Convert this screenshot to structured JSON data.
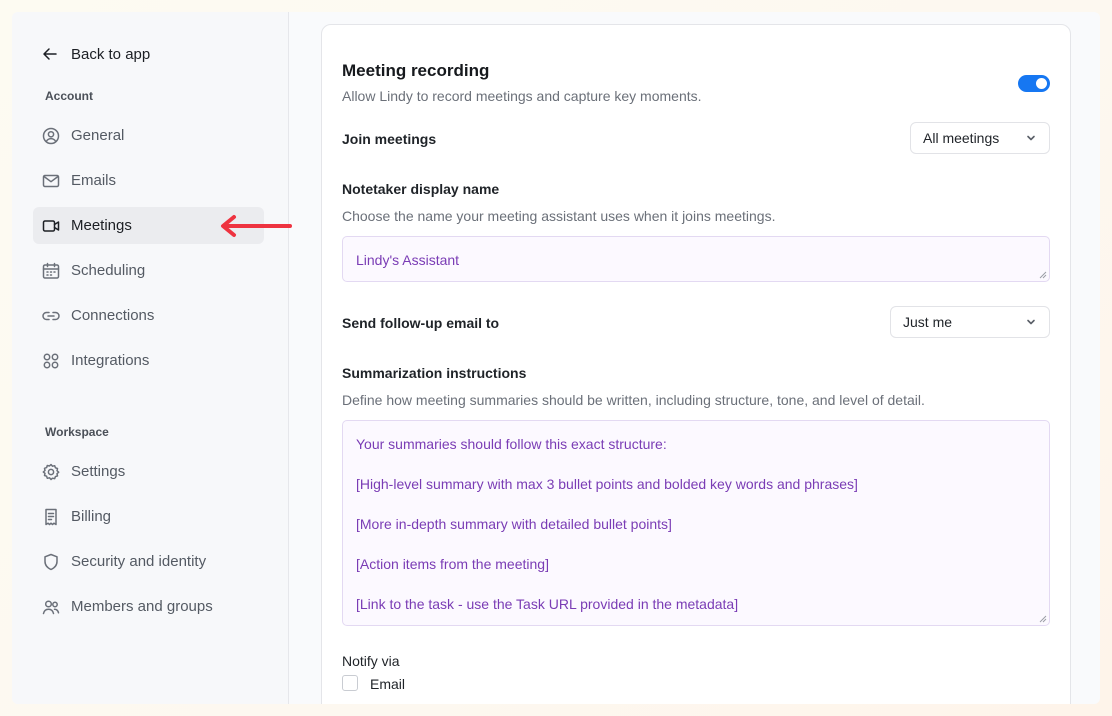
{
  "sidebar": {
    "back_label": "Back to app",
    "account_heading": "Account",
    "workspace_heading": "Workspace",
    "account_items": [
      {
        "label": "General",
        "icon": "user-circle-icon"
      },
      {
        "label": "Emails",
        "icon": "mail-icon"
      },
      {
        "label": "Meetings",
        "icon": "video-icon",
        "active": true
      },
      {
        "label": "Scheduling",
        "icon": "calendar-icon"
      },
      {
        "label": "Connections",
        "icon": "link-icon"
      },
      {
        "label": "Integrations",
        "icon": "grid-icon"
      }
    ],
    "workspace_items": [
      {
        "label": "Settings",
        "icon": "gear-icon"
      },
      {
        "label": "Billing",
        "icon": "receipt-icon"
      },
      {
        "label": "Security and identity",
        "icon": "shield-icon"
      },
      {
        "label": "Members and groups",
        "icon": "users-icon"
      }
    ]
  },
  "annotation": {
    "arrow_color": "#ee3340"
  },
  "main": {
    "title": "Meeting recording",
    "description": "Allow Lindy to record meetings and capture key moments.",
    "recording_enabled": true,
    "accent_color": "#1677f2",
    "join_meetings": {
      "label": "Join meetings",
      "value": "All meetings"
    },
    "notetaker": {
      "label": "Notetaker display name",
      "description": "Choose the name your meeting assistant uses when it joins meetings.",
      "value": "Lindy's Assistant"
    },
    "follow_up": {
      "label": "Send follow-up email to",
      "value": "Just me"
    },
    "summarization": {
      "label": "Summarization instructions",
      "description": "Define how meeting summaries should be written, including structure, tone, and level of detail.",
      "lines": [
        "Your summaries should follow this exact structure:",
        "[High-level summary with max 3 bullet points and bolded key words and phrases]",
        "[More in-depth summary with detailed bullet points]",
        "[Action items from the meeting]",
        "[Link to the task - use the Task URL provided in the metadata]"
      ]
    },
    "notify": {
      "label": "Notify via",
      "options": [
        {
          "label": "Email",
          "checked": false
        }
      ]
    }
  }
}
